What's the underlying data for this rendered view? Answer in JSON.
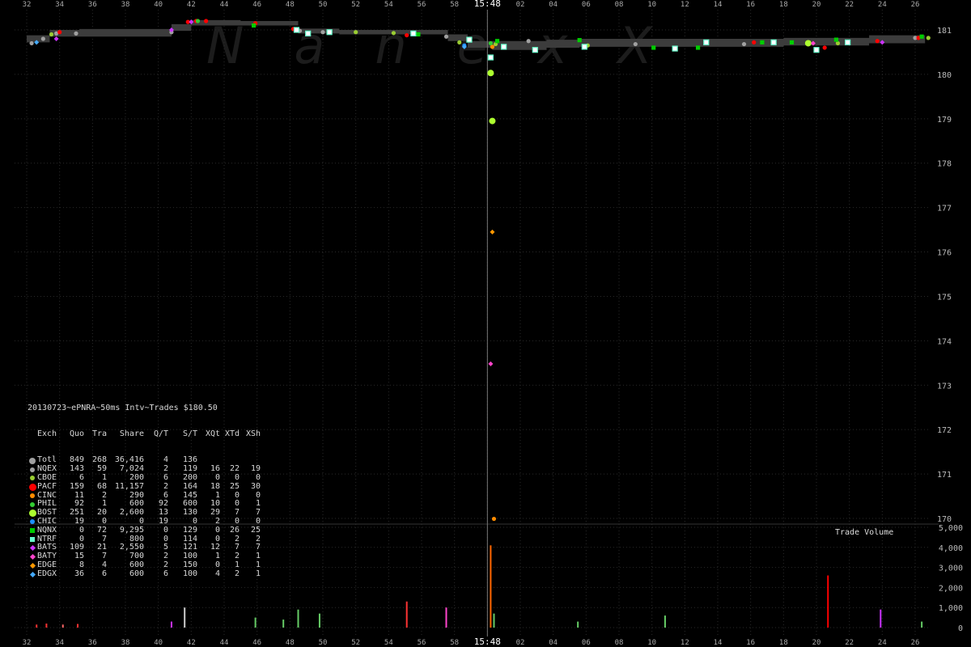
{
  "watermark": "NanexX",
  "header_time_label": "15:48",
  "chart_data": {
    "type": "scatter",
    "title": "20130723~ePNRA~50ms Intv~Trades $180.50",
    "x_ticks": [
      "32",
      "34",
      "36",
      "38",
      "40",
      "42",
      "44",
      "46",
      "48",
      "50",
      "52",
      "54",
      "56",
      "58",
      "15:48",
      "02",
      "04",
      "06",
      "08",
      "10",
      "12",
      "14",
      "16",
      "18",
      "20",
      "22",
      "24",
      "26"
    ],
    "y_price_ticks": [
      "181",
      "180",
      "179",
      "178",
      "177",
      "176",
      "175",
      "174",
      "173",
      "172",
      "171",
      "170"
    ],
    "ylim_price": [
      169.9,
      181.4
    ],
    "y_volume_ticks": [
      "5,000",
      "4,000",
      "3,000",
      "2,000",
      "1,000",
      "0"
    ],
    "ylim_volume": [
      0,
      5000
    ],
    "volume_label": "Trade Volume",
    "grid": true,
    "x_unit": "seconds (15:47:32 to 15:48:26)",
    "quote_band": [
      {
        "x": 32.0,
        "lo": 180.72,
        "hi": 180.88
      },
      {
        "x": 33.4,
        "lo": 180.72,
        "hi": 180.88
      },
      {
        "x": 33.4,
        "lo": 180.85,
        "hi": 181.0
      },
      {
        "x": 35.2,
        "lo": 180.85,
        "hi": 181.0
      },
      {
        "x": 35.2,
        "lo": 180.85,
        "hi": 181.02
      },
      {
        "x": 40.8,
        "lo": 180.85,
        "hi": 181.02
      },
      {
        "x": 40.8,
        "lo": 180.98,
        "hi": 181.13
      },
      {
        "x": 42.0,
        "lo": 180.98,
        "hi": 181.13
      },
      {
        "x": 42.0,
        "lo": 181.1,
        "hi": 181.22
      },
      {
        "x": 45.0,
        "lo": 181.1,
        "hi": 181.22
      },
      {
        "x": 45.0,
        "lo": 181.1,
        "hi": 181.2
      },
      {
        "x": 48.5,
        "lo": 181.1,
        "hi": 181.2
      },
      {
        "x": 48.5,
        "lo": 180.92,
        "hi": 181.03
      },
      {
        "x": 51.0,
        "lo": 180.92,
        "hi": 181.03
      },
      {
        "x": 51.0,
        "lo": 180.9,
        "hi": 181.0
      },
      {
        "x": 57.6,
        "lo": 180.9,
        "hi": 181.0
      },
      {
        "x": 57.6,
        "lo": 180.75,
        "hi": 180.9
      },
      {
        "x": 58.8,
        "lo": 180.75,
        "hi": 180.9
      },
      {
        "x": 58.8,
        "lo": 180.6,
        "hi": 180.75
      },
      {
        "x": 60.3,
        "lo": 180.6,
        "hi": 180.75
      },
      {
        "x": 60.3,
        "lo": 180.55,
        "hi": 180.75
      },
      {
        "x": 63.6,
        "lo": 180.55,
        "hi": 180.75
      },
      {
        "x": 63.6,
        "lo": 180.6,
        "hi": 180.78
      },
      {
        "x": 65.6,
        "lo": 180.6,
        "hi": 180.78
      },
      {
        "x": 65.6,
        "lo": 180.62,
        "hi": 180.8
      },
      {
        "x": 78.0,
        "lo": 180.62,
        "hi": 180.8
      },
      {
        "x": 78.0,
        "lo": 180.65,
        "hi": 180.82
      },
      {
        "x": 83.2,
        "lo": 180.65,
        "hi": 180.82
      },
      {
        "x": 83.2,
        "lo": 180.7,
        "hi": 180.88
      },
      {
        "x": 86.6,
        "lo": 180.7,
        "hi": 180.88
      },
      {
        "x": 86.6,
        "lo": 180.72,
        "hi": 180.95
      }
    ],
    "series": [
      {
        "name": "NQEX",
        "color": "#a0a0a0",
        "shape": "circle",
        "points": [
          [
            32.3,
            180.7
          ],
          [
            33.0,
            180.8
          ],
          [
            33.8,
            180.92
          ],
          [
            35.0,
            180.92
          ],
          [
            40.8,
            180.95
          ],
          [
            48.6,
            180.98
          ],
          [
            50.0,
            180.95
          ],
          [
            57.5,
            180.85
          ],
          [
            62.5,
            180.75
          ],
          [
            69.0,
            180.68
          ],
          [
            75.6,
            180.68
          ],
          [
            86.0,
            180.82
          ]
        ]
      },
      {
        "name": "CBOE",
        "color": "#9acd32",
        "shape": "circle",
        "points": [
          [
            33.5,
            180.9
          ],
          [
            52.0,
            180.95
          ],
          [
            54.3,
            180.93
          ],
          [
            58.3,
            180.72
          ],
          [
            60.5,
            180.68
          ],
          [
            66.1,
            180.65
          ],
          [
            81.3,
            180.7
          ],
          [
            86.8,
            180.82
          ]
        ]
      },
      {
        "name": "PACF",
        "color": "#ff0000",
        "shape": "circle",
        "points": [
          [
            34.0,
            180.95
          ],
          [
            41.8,
            181.18
          ],
          [
            42.3,
            181.2
          ],
          [
            42.9,
            181.2
          ],
          [
            45.9,
            181.15
          ],
          [
            48.2,
            181.02
          ],
          [
            55.1,
            180.88
          ],
          [
            76.2,
            180.72
          ],
          [
            80.5,
            180.6
          ],
          [
            83.7,
            180.75
          ],
          [
            86.2,
            180.82
          ]
        ]
      },
      {
        "name": "CINC",
        "color": "#ff8c00",
        "shape": "circle",
        "points": [
          [
            60.3,
            180.62
          ],
          [
            60.4,
            169.99
          ]
        ]
      },
      {
        "name": "PHIL",
        "color": "#32cd32",
        "shape": "circle",
        "points": [
          [
            42.4,
            181.2
          ],
          [
            60.2,
            180.7
          ]
        ]
      },
      {
        "name": "BOST",
        "color": "#adff2f",
        "shape": "circle",
        "points": [
          [
            60.2,
            180.03
          ],
          [
            60.3,
            178.95
          ],
          [
            79.5,
            180.7
          ]
        ]
      },
      {
        "name": "CHIC",
        "color": "#1e90ff",
        "shape": "circle",
        "points": [
          [
            58.6,
            180.65
          ]
        ]
      },
      {
        "name": "NQNX",
        "color": "#00cc00",
        "shape": "square",
        "points": [
          [
            45.8,
            181.1
          ],
          [
            55.8,
            180.9
          ],
          [
            60.6,
            180.75
          ],
          [
            65.6,
            180.77
          ],
          [
            70.1,
            180.6
          ],
          [
            72.8,
            180.6
          ],
          [
            76.7,
            180.72
          ],
          [
            78.5,
            180.72
          ],
          [
            81.2,
            180.78
          ],
          [
            86.4,
            180.85
          ]
        ]
      },
      {
        "name": "NTRF",
        "color": "#66ffcc",
        "shape": "square",
        "points": [
          [
            48.4,
            181.0
          ],
          [
            49.1,
            180.92
          ],
          [
            50.4,
            180.95
          ],
          [
            55.5,
            180.92
          ],
          [
            58.9,
            180.78
          ],
          [
            60.2,
            180.38
          ],
          [
            61.0,
            180.62
          ],
          [
            62.9,
            180.55
          ],
          [
            65.9,
            180.62
          ],
          [
            71.4,
            180.58
          ],
          [
            73.3,
            180.72
          ],
          [
            77.4,
            180.72
          ],
          [
            80.0,
            180.55
          ],
          [
            81.9,
            180.72
          ]
        ]
      },
      {
        "name": "BATS",
        "color": "#cc33ff",
        "shape": "diamond",
        "points": [
          [
            33.8,
            180.8
          ],
          [
            40.8,
            181.0
          ],
          [
            42.0,
            181.18
          ],
          [
            84.0,
            180.72
          ]
        ]
      },
      {
        "name": "BATY",
        "color": "#ff44cc",
        "shape": "diamond",
        "points": [
          [
            60.2,
            173.48
          ],
          [
            79.8,
            180.7
          ]
        ]
      },
      {
        "name": "EDGE",
        "color": "#ff9900",
        "shape": "diamond",
        "points": [
          [
            60.3,
            176.45
          ]
        ]
      },
      {
        "name": "EDGX",
        "color": "#44aaff",
        "shape": "diamond",
        "points": [
          [
            58.6,
            180.62
          ],
          [
            32.6,
            180.72
          ]
        ]
      }
    ],
    "volume_bars": [
      {
        "x": 32.6,
        "v": 150,
        "color": "#ff3333"
      },
      {
        "x": 33.2,
        "v": 200,
        "color": "#ff3333"
      },
      {
        "x": 34.2,
        "v": 150,
        "color": "#ff6666"
      },
      {
        "x": 35.1,
        "v": 180,
        "color": "#ff3333"
      },
      {
        "x": 40.8,
        "v": 300,
        "color": "#cc33ff"
      },
      {
        "x": 41.6,
        "v": 1000,
        "color": "#cccccc"
      },
      {
        "x": 45.9,
        "v": 500,
        "color": "#66cc66"
      },
      {
        "x": 47.6,
        "v": 400,
        "color": "#66cc66"
      },
      {
        "x": 48.5,
        "v": 900,
        "color": "#66cc66"
      },
      {
        "x": 49.8,
        "v": 700,
        "color": "#66cc66"
      },
      {
        "x": 55.1,
        "v": 1300,
        "color": "#ff3333"
      },
      {
        "x": 57.5,
        "v": 1000,
        "color": "#ff44cc"
      },
      {
        "x": 60.2,
        "v": 4100,
        "color": "#ff6600"
      },
      {
        "x": 60.4,
        "v": 700,
        "color": "#66cc66"
      },
      {
        "x": 65.5,
        "v": 300,
        "color": "#66cc66"
      },
      {
        "x": 70.8,
        "v": 600,
        "color": "#66cc66"
      },
      {
        "x": 80.7,
        "v": 2600,
        "color": "#ff0000"
      },
      {
        "x": 83.9,
        "v": 900,
        "color": "#cc33ff"
      },
      {
        "x": 86.4,
        "v": 300,
        "color": "#66cc66"
      }
    ]
  },
  "legend": {
    "title": "20130723~ePNRA~50ms Intv~Trades $180.50",
    "headers": [
      "Exch",
      "Quo",
      "Tra",
      "Share",
      "Q/T",
      "S/T",
      "XQt",
      "XTd",
      "XSh"
    ],
    "rows": [
      {
        "sym": "circle",
        "color": "#a0a0a0",
        "cells": [
          "Totl",
          "849",
          "268",
          "36,416",
          "4",
          "136",
          "",
          "",
          ""
        ]
      },
      {
        "sym": "circle",
        "color": "#a0a0a0",
        "cells": [
          "NQEX",
          "143",
          "59",
          "7,024",
          "2",
          "119",
          "16",
          "22",
          "19"
        ]
      },
      {
        "sym": "circle",
        "color": "#9acd32",
        "cells": [
          "CBOE",
          "6",
          "1",
          "200",
          "6",
          "200",
          "0",
          "0",
          "0"
        ]
      },
      {
        "sym": "circle",
        "color": "#ff0000",
        "cells": [
          "PACF",
          "159",
          "68",
          "11,157",
          "2",
          "164",
          "18",
          "25",
          "30"
        ]
      },
      {
        "sym": "circle",
        "color": "#ff8c00",
        "cells": [
          "CINC",
          "11",
          "2",
          "290",
          "6",
          "145",
          "1",
          "0",
          "0"
        ]
      },
      {
        "sym": "circle",
        "color": "#32cd32",
        "cells": [
          "PHIL",
          "92",
          "1",
          "600",
          "92",
          "600",
          "10",
          "0",
          "1"
        ]
      },
      {
        "sym": "circle",
        "color": "#adff2f",
        "cells": [
          "BOST",
          "251",
          "20",
          "2,600",
          "13",
          "130",
          "29",
          "7",
          "7"
        ]
      },
      {
        "sym": "circle",
        "color": "#1e90ff",
        "cells": [
          "CHIC",
          "19",
          "0",
          "0",
          "19",
          "0",
          "2",
          "0",
          "0"
        ]
      },
      {
        "sym": "square",
        "color": "#00cc00",
        "cells": [
          "NQNX",
          "0",
          "72",
          "9,295",
          "0",
          "129",
          "0",
          "26",
          "25"
        ]
      },
      {
        "sym": "square",
        "color": "#66ffcc",
        "cells": [
          "NTRF",
          "0",
          "7",
          "800",
          "0",
          "114",
          "0",
          "2",
          "2"
        ]
      },
      {
        "sym": "diamond",
        "color": "#cc33ff",
        "cells": [
          "BATS",
          "109",
          "21",
          "2,550",
          "5",
          "121",
          "12",
          "7",
          "7"
        ]
      },
      {
        "sym": "diamond",
        "color": "#ff44cc",
        "cells": [
          "BATY",
          "15",
          "7",
          "700",
          "2",
          "100",
          "1",
          "2",
          "1"
        ]
      },
      {
        "sym": "diamond",
        "color": "#ff9900",
        "cells": [
          "EDGE",
          "8",
          "4",
          "600",
          "2",
          "150",
          "0",
          "1",
          "1"
        ]
      },
      {
        "sym": "diamond",
        "color": "#44aaff",
        "cells": [
          "EDGX",
          "36",
          "6",
          "600",
          "6",
          "100",
          "4",
          "2",
          "1"
        ]
      }
    ]
  }
}
